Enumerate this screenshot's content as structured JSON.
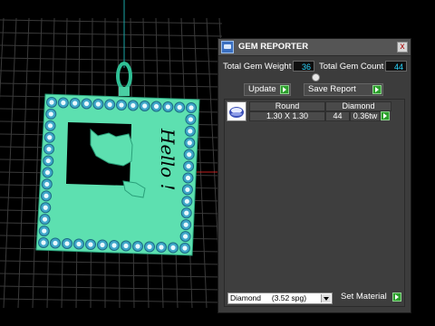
{
  "viewport": {
    "pendant_text": "Hello !",
    "colors": {
      "background": "#000000",
      "grid": "#3a3a3a",
      "pendant": "#5de0b0",
      "axis_y": "#1aa6a6",
      "axis_x": "#c02020"
    }
  },
  "panel": {
    "title": "GEM REPORTER",
    "close_label": "x",
    "total_weight_label": "Total Gem Weight",
    "total_weight_value": "36",
    "total_count_label": "Total Gem Count",
    "total_count_value": "44",
    "update_label": "Update",
    "save_report_label": "Save Report",
    "gem_row": {
      "shape": "Round",
      "size": "1.30 X 1.30",
      "material": "Diamond",
      "count": "44",
      "weight": "0.36tw"
    },
    "material_select": "Diamond     (3.52 spg)",
    "set_material_label": "Set Material"
  }
}
